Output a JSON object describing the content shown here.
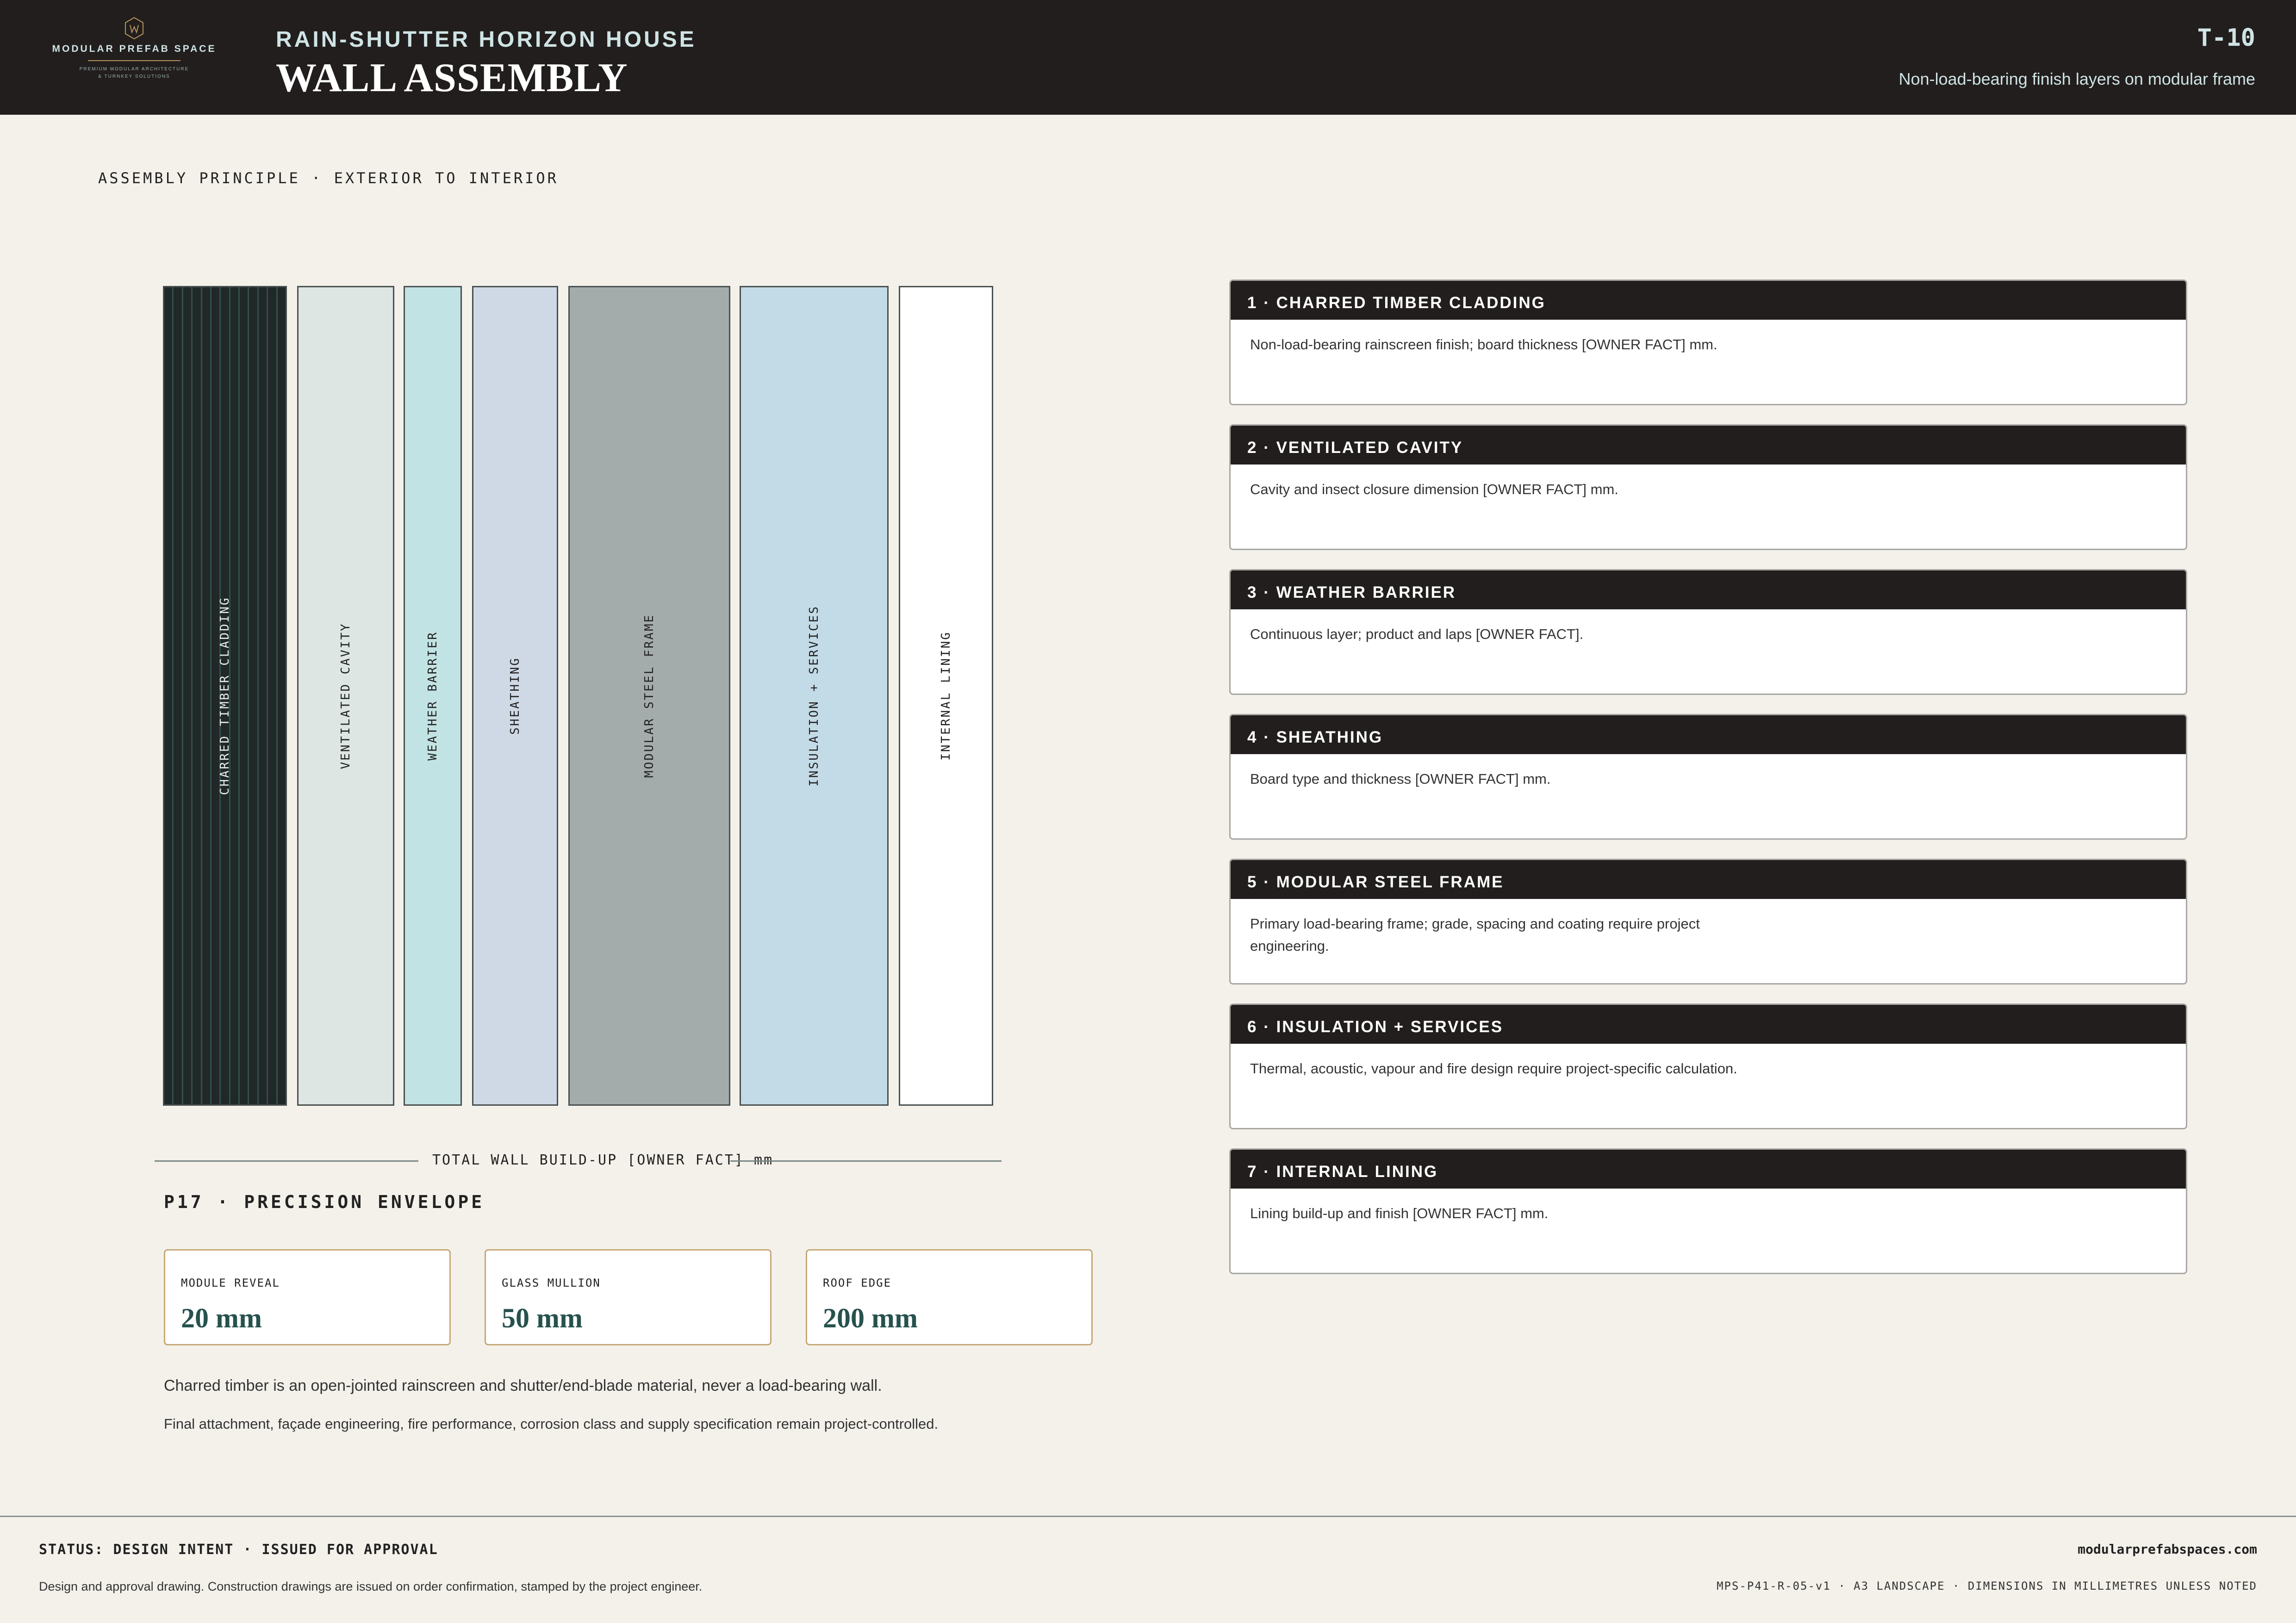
{
  "header": {
    "brand_name": "MODULAR PREFAB SPACE",
    "brand_tagline_1": "PREMIUM MODULAR ARCHITECTURE",
    "brand_tagline_2": "& TURNKEY SOLUTIONS",
    "project_name": "RAIN-SHUTTER HORIZON HOUSE",
    "sheet_title": "WALL ASSEMBLY",
    "sheet_number": "T-10",
    "sheet_subtitle": "Non-load-bearing finish layers on modular frame"
  },
  "section_label": "ASSEMBLY PRINCIPLE · EXTERIOR TO INTERIOR",
  "layers": [
    {
      "label": "CHARRED TIMBER CLADDING",
      "color": "#212828"
    },
    {
      "label": "VENTILATED CAVITY",
      "color": "#dde6e2"
    },
    {
      "label": "WEATHER BARRIER",
      "color": "#c2e3e4"
    },
    {
      "label": "SHEATHING",
      "color": "#cfd9e6"
    },
    {
      "label": "MODULAR STEEL FRAME",
      "color": "#a4abab"
    },
    {
      "label": "INSULATION + SERVICES",
      "color": "#c3dbe6"
    },
    {
      "label": "INTERNAL LINING",
      "color": "#ffffff"
    }
  ],
  "total_buildup": "TOTAL WALL BUILD-UP [OWNER FACT] mm",
  "precision": {
    "title": "P17 · PRECISION ENVELOPE",
    "metrics": [
      {
        "label": "MODULE REVEAL",
        "value": "20 mm"
      },
      {
        "label": "GLASS MULLION",
        "value": "50 mm"
      },
      {
        "label": "ROOF EDGE",
        "value": "200 mm"
      }
    ]
  },
  "notes": [
    "Charred timber is an open-jointed rainscreen and shutter/end-blade material, never a load-bearing wall.",
    "Final attachment, façade engineering, fire performance, corrosion class and supply specification remain project-controlled."
  ],
  "specs": [
    {
      "title": "1 · CHARRED TIMBER CLADDING",
      "body": "Non-load-bearing rainscreen finish; board thickness [OWNER FACT] mm."
    },
    {
      "title": "2 · VENTILATED CAVITY",
      "body": "Cavity and insect closure dimension [OWNER FACT] mm."
    },
    {
      "title": "3 · WEATHER BARRIER",
      "body": "Continuous layer; product and laps [OWNER FACT]."
    },
    {
      "title": "4 · SHEATHING",
      "body": "Board type and thickness [OWNER FACT] mm."
    },
    {
      "title": "5 · MODULAR STEEL FRAME",
      "body": "Primary load-bearing frame; grade, spacing and coating require project engineering."
    },
    {
      "title": "6 · INSULATION + SERVICES",
      "body": "Thermal, acoustic, vapour and fire design require project-specific calculation."
    },
    {
      "title": "7 · INTERNAL LINING",
      "body": "Lining build-up and finish [OWNER FACT] mm."
    }
  ],
  "footer": {
    "status": "STATUS: DESIGN INTENT · ISSUED FOR APPROVAL",
    "note": "Design and approval drawing. Construction drawings are issued on order confirmation, stamped by the project engineer.",
    "url": "modularprefabspaces.com",
    "reference": "MPS-P41-R-05-v1 · A3 LANDSCAPE · DIMENSIONS IN MILLIMETRES UNLESS NOTED"
  }
}
